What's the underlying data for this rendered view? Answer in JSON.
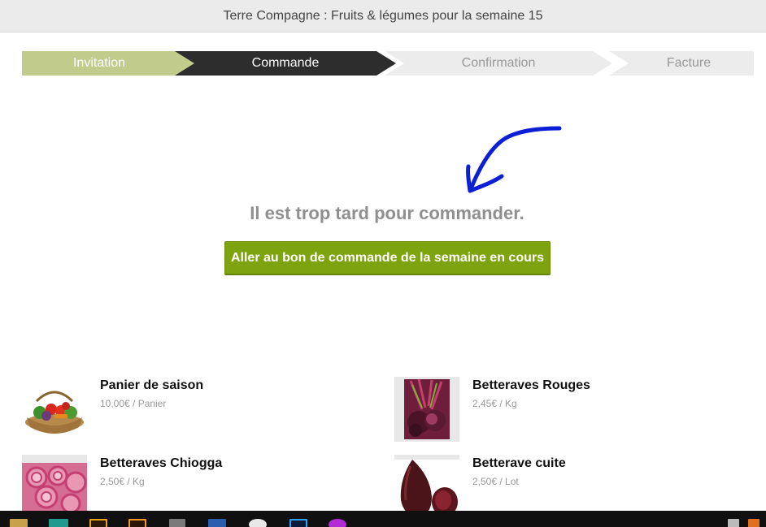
{
  "header": {
    "title": "Terre Compagne : Fruits & légumes pour la semaine 15"
  },
  "steps": [
    {
      "label": "Invitation",
      "state": "done"
    },
    {
      "label": "Commande",
      "state": "active"
    },
    {
      "label": "Confirmation",
      "state": "pending"
    },
    {
      "label": "Facture",
      "state": "pending"
    }
  ],
  "main": {
    "message": "Il est trop tard pour commander.",
    "button_label": "Aller au bon de commande de la semaine en cours"
  },
  "products": [
    {
      "name": "Panier de saison",
      "price": "10,00€ / Panier"
    },
    {
      "name": "Betteraves Rouges",
      "price": "2,45€ / Kg"
    },
    {
      "name": "Betteraves Chiogga",
      "price": "2,50€ / Kg"
    },
    {
      "name": "Betterave cuite",
      "price": "2,50€ / Lot"
    }
  ],
  "colors": {
    "step_done": "#c0cb8c",
    "step_active": "#2d2d2d",
    "step_pending": "#ececec",
    "button": "#7da30e",
    "annotation_arrow": "#0a1fd6"
  }
}
